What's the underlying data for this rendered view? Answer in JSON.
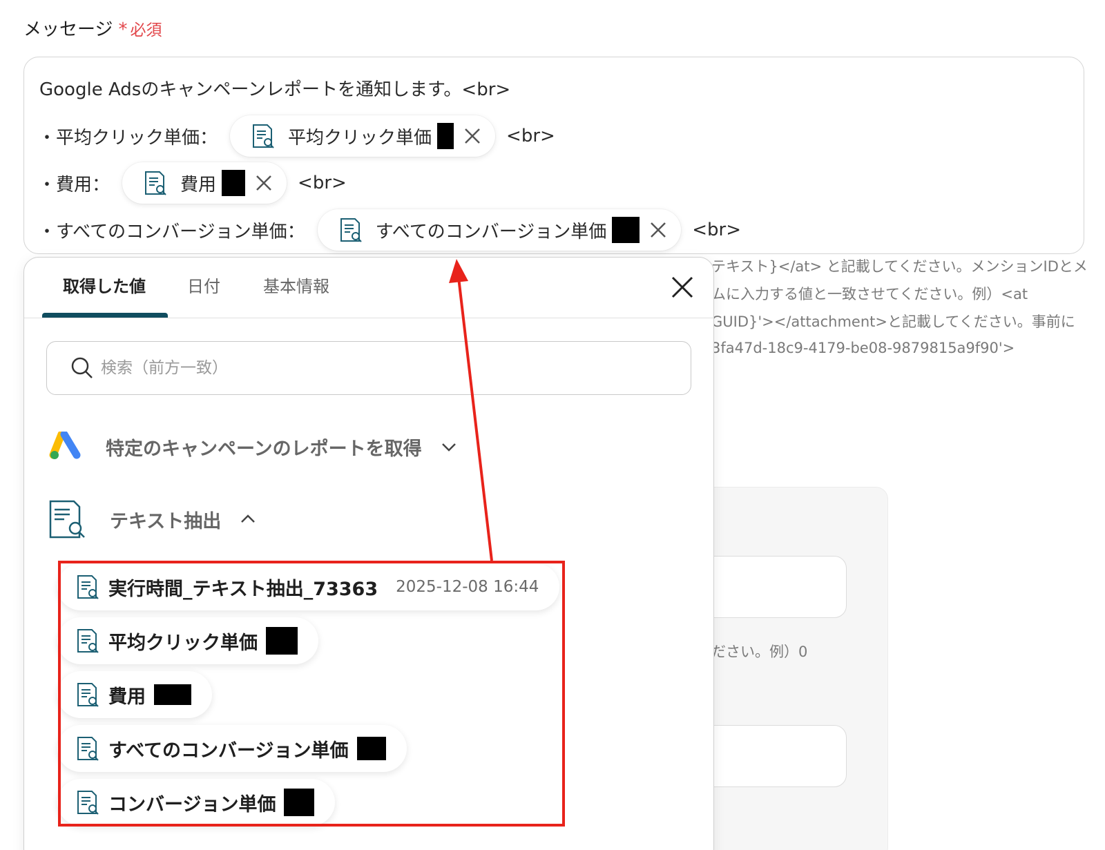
{
  "field": {
    "label": "メッセージ",
    "required_star": "*",
    "required_text": "必須"
  },
  "message": {
    "line1": "Google Adsのキャンペーンレポートを通知します。<br>",
    "line2_prefix": "・平均クリック単価：",
    "line3_prefix": "・費用：",
    "line4_prefix": "・すべてのコンバージョン単価：",
    "br": "<br>",
    "chips": [
      {
        "label": "平均クリック単価"
      },
      {
        "label": "費用"
      },
      {
        "label": "すべてのコンバージョン単価"
      }
    ]
  },
  "help_lines": [
    "テキスト}</at> と記載してください。メンションIDとメ",
    "ムに入力する値と一致させてください。例）<at",
    "GUID}'></attachment>と記載してください。事前に",
    "3fa47d-18c9-4179-be08-9879815a9f90'>"
  ],
  "bg_hint": "ださい。例）0",
  "popup": {
    "tabs": [
      "取得した値",
      "日付",
      "基本情報"
    ],
    "active_tab": 0,
    "search_placeholder": "検索（前方一致）",
    "groups": [
      {
        "title": "特定のキャンペーンのレポートを取得",
        "icon": "google-ads-icon",
        "expanded": false
      },
      {
        "title": "テキスト抽出",
        "icon": "text-extract-icon",
        "expanded": true
      }
    ],
    "items": [
      {
        "label": "実行時間_テキスト抽出_73363",
        "time": "2025-12-08 16:44"
      },
      {
        "label": "平均クリック単価"
      },
      {
        "label": "費用"
      },
      {
        "label": "すべてのコンバージョン単価"
      },
      {
        "label": "コンバージョン単価"
      }
    ]
  },
  "colors": {
    "required": "#e2464a",
    "tab_underline": "#104d5f",
    "highlight": "#e8231b",
    "google_blue": "#4285f4",
    "google_yellow": "#fbbc04",
    "google_green": "#34a853"
  }
}
